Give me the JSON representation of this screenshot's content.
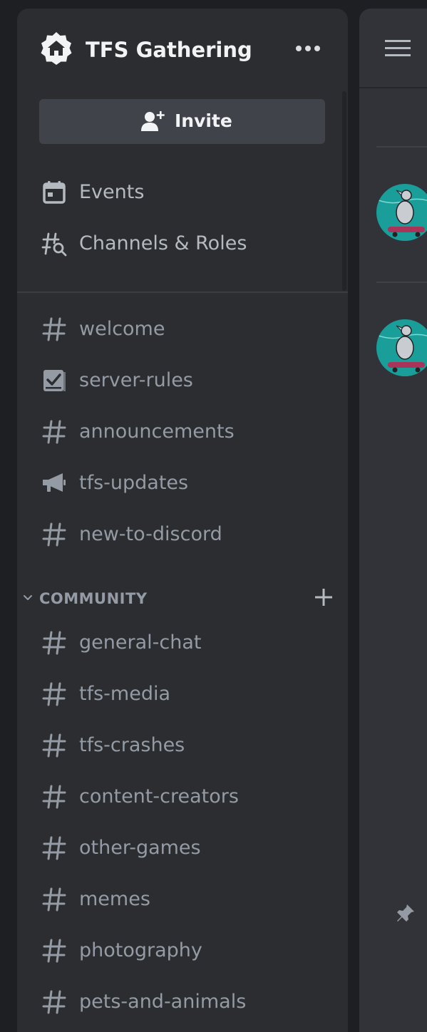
{
  "server": {
    "name": "TFS Gathering",
    "icon": "home-icon"
  },
  "invite": {
    "label": "Invite",
    "icon": "add-user-icon"
  },
  "menu": [
    {
      "label": "Events",
      "icon": "calendar-icon"
    },
    {
      "label": "Channels & Roles",
      "icon": "channel-browse-icon"
    }
  ],
  "channels_top": [
    {
      "label": "welcome",
      "icon": "hash-icon"
    },
    {
      "label": "server-rules",
      "icon": "rules-icon"
    },
    {
      "label": "announcements",
      "icon": "hash-icon"
    },
    {
      "label": "tfs-updates",
      "icon": "megaphone-icon"
    },
    {
      "label": "new-to-discord",
      "icon": "hash-icon"
    }
  ],
  "category": {
    "label": "COMMUNITY",
    "channels": [
      {
        "label": "general-chat",
        "icon": "hash-icon"
      },
      {
        "label": "tfs-media",
        "icon": "hash-icon"
      },
      {
        "label": "tfs-crashes",
        "icon": "hash-icon"
      },
      {
        "label": "content-creators",
        "icon": "hash-icon"
      },
      {
        "label": "other-games",
        "icon": "hash-icon"
      },
      {
        "label": "memes",
        "icon": "hash-icon"
      },
      {
        "label": "photography",
        "icon": "hash-icon"
      },
      {
        "label": "pets-and-animals",
        "icon": "hash-icon"
      }
    ]
  },
  "main": {
    "icons": [
      "hamburger-menu-icon",
      "pin-icon"
    ],
    "avatar": "skateboarding-bird-avatar"
  },
  "colors": {
    "background": "#1e1f22",
    "sidebar": "#2b2d31",
    "main": "#313338",
    "invite_button": "#41434a",
    "text_primary": "#f2f3f5",
    "text_muted": "#949ba4",
    "avatar_bg": "#1a9e9a"
  }
}
